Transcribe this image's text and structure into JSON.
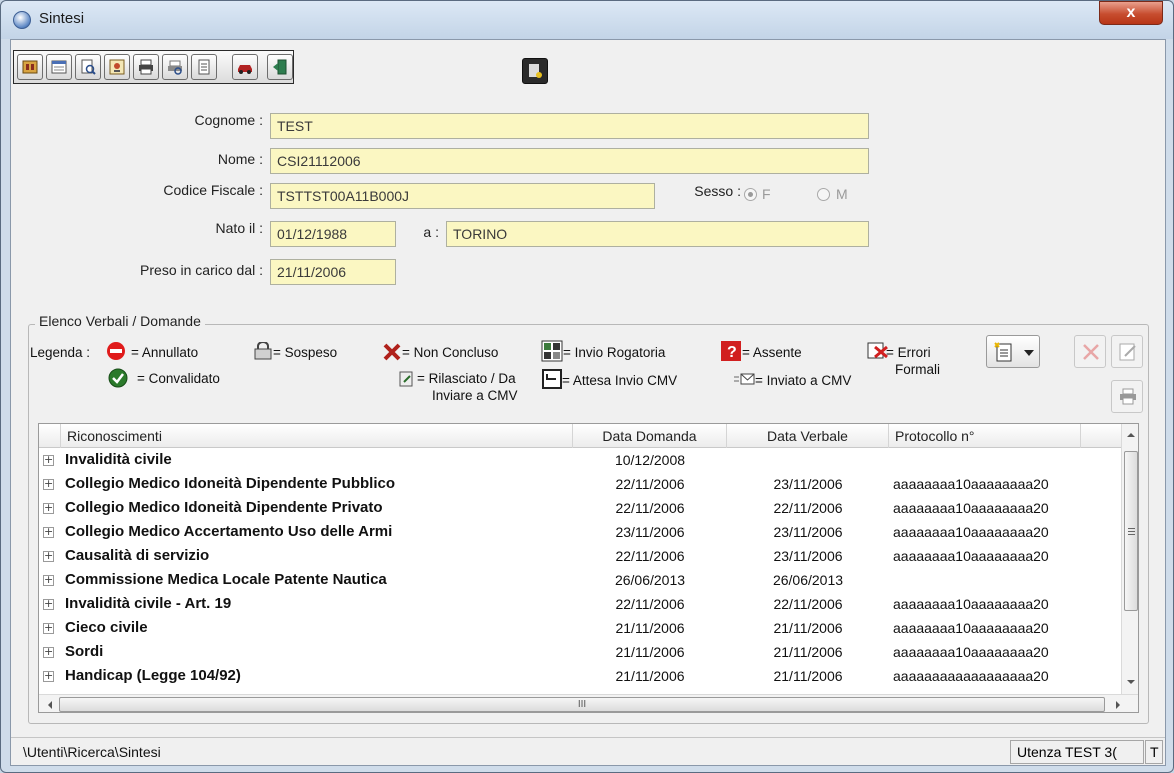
{
  "window": {
    "title": "Sintesi",
    "close_label": "x"
  },
  "toolbar": {
    "icons": [
      "patient-card-icon",
      "calendar-icon",
      "search-document-icon",
      "certificate-icon",
      "printer-icon",
      "print-preview-icon",
      "notes-icon",
      "car-icon",
      "exit-door-icon",
      "settings-report-icon"
    ]
  },
  "form": {
    "cognome_label": "Cognome :",
    "cognome_value": "TEST",
    "nome_label": "Nome :",
    "nome_value": "CSI21112006",
    "cf_label": "Codice Fiscale :",
    "cf_value": "TSTTST00A11B000J",
    "sesso_label": "Sesso :",
    "sesso_f": "F",
    "sesso_m": "M",
    "sesso_selected": "F",
    "nato_label": "Nato il :",
    "nato_value": "01/12/1988",
    "a_label": "a :",
    "a_value": "TORINO",
    "preso_label": "Preso in carico dal :",
    "preso_value": "21/11/2006"
  },
  "group": {
    "title": "Elenco Verbali / Domande"
  },
  "legend": {
    "prefix": "Legenda :",
    "annullato": "= Annullato",
    "sospeso": "= Sospeso",
    "non_concluso": "= Non Concluso",
    "invio_rogatoria": "= Invio Rogatoria",
    "assente": "= Assente",
    "errori_1": "= Errori",
    "errori_2": "Formali",
    "convalidato": "= Convalidato",
    "rilasciato_1": "= Rilasciato / Da",
    "rilasciato_2": "Inviare a CMV",
    "attesa": "= Attesa Invio CMV",
    "inviato": "= Inviato a CMV"
  },
  "grid": {
    "columns": [
      "Riconoscimenti",
      "Data Domanda",
      "Data Verbale",
      "Protocollo n°"
    ],
    "rows": [
      {
        "name": "Invalidità civile",
        "data_domanda": "10/12/2008",
        "data_verbale": "",
        "protocollo": ""
      },
      {
        "name": "Collegio Medico Idoneità Dipendente Pubblico",
        "data_domanda": "22/11/2006",
        "data_verbale": "23/11/2006",
        "protocollo": "aaaaaaaa10aaaaaaaa20"
      },
      {
        "name": "Collegio Medico Idoneità Dipendente Privato",
        "data_domanda": "22/11/2006",
        "data_verbale": "22/11/2006",
        "protocollo": "aaaaaaaa10aaaaaaaa20"
      },
      {
        "name": "Collegio Medico Accertamento Uso delle Armi",
        "data_domanda": "23/11/2006",
        "data_verbale": "23/11/2006",
        "protocollo": "aaaaaaaa10aaaaaaaa20"
      },
      {
        "name": "Causalità di servizio",
        "data_domanda": "22/11/2006",
        "data_verbale": "23/11/2006",
        "protocollo": "aaaaaaaa10aaaaaaaa20"
      },
      {
        "name": "Commissione Medica Locale Patente Nautica",
        "data_domanda": "26/06/2013",
        "data_verbale": "26/06/2013",
        "protocollo": ""
      },
      {
        "name": "Invalidità civile - Art. 19",
        "data_domanda": "22/11/2006",
        "data_verbale": "22/11/2006",
        "protocollo": "aaaaaaaa10aaaaaaaa20"
      },
      {
        "name": "Cieco civile",
        "data_domanda": "21/11/2006",
        "data_verbale": "21/11/2006",
        "protocollo": "aaaaaaaa10aaaaaaaa20"
      },
      {
        "name": "Sordi",
        "data_domanda": "21/11/2006",
        "data_verbale": "21/11/2006",
        "protocollo": "aaaaaaaa10aaaaaaaa20"
      },
      {
        "name": "Handicap (Legge 104/92)",
        "data_domanda": "21/11/2006",
        "data_verbale": "21/11/2006",
        "protocollo": "aaaaaaaaaaaaaaaaaa20"
      }
    ],
    "hscroll_thumb": "III"
  },
  "status": {
    "path": "\\Utenti\\Ricerca\\Sintesi",
    "user": "Utenza TEST 3(",
    "mode": "T"
  }
}
